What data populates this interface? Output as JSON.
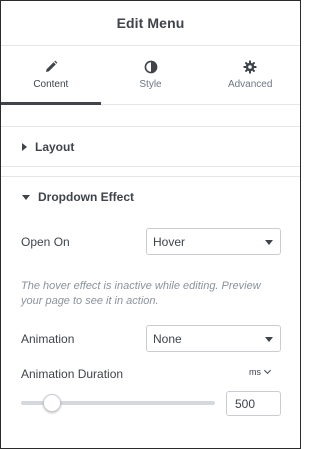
{
  "header": {
    "title": "Edit Menu"
  },
  "tabs": [
    {
      "label": "Content",
      "icon": "pencil-icon",
      "active": true
    },
    {
      "label": "Style",
      "icon": "contrast-icon",
      "active": false
    },
    {
      "label": "Advanced",
      "icon": "gear-icon",
      "active": false
    }
  ],
  "sections": {
    "layout": {
      "title": "Layout",
      "expanded": false
    },
    "dropdown_effect": {
      "title": "Dropdown Effect",
      "expanded": true
    }
  },
  "controls": {
    "open_on": {
      "label": "Open On",
      "value": "Hover"
    },
    "note": "The hover effect is inactive while editing. Preview your page to see it in action.",
    "animation": {
      "label": "Animation",
      "value": "None"
    },
    "animation_duration": {
      "label": "Animation Duration",
      "unit": "ms",
      "value": "500",
      "slider_fraction": 0.16
    }
  },
  "colors": {
    "text": "#3f444b",
    "muted": "#8a929b",
    "border": "#c9cdd2",
    "divider": "#e4e6e9"
  }
}
